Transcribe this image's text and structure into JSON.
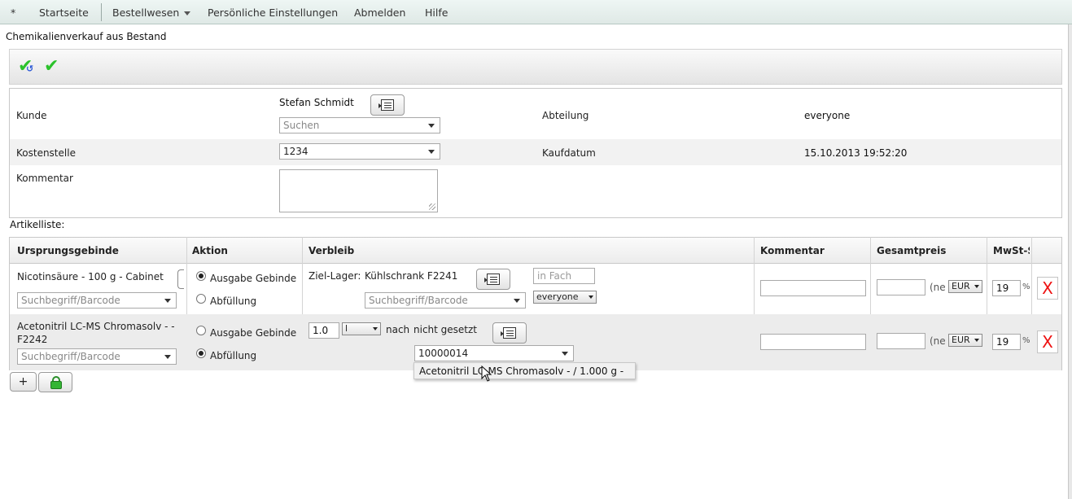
{
  "menu": {
    "star": "*",
    "home": "Startseite",
    "ordering": "Bestellwesen",
    "personal_settings": "Persönliche Einstellungen",
    "logout": "Abmelden",
    "help": "Hilfe"
  },
  "page_title": "Chemikalienverkauf aus Bestand",
  "form": {
    "customer_label": "Kunde",
    "customer_name": "Stefan Schmidt",
    "customer_search_placeholder": "Suchen",
    "department_label": "Abteilung",
    "department_value": "everyone",
    "cost_center_label": "Kostenstelle",
    "cost_center_value": "1234",
    "purchase_date_label": "Kaufdatum",
    "purchase_date_value": "15.10.2013 19:52:20",
    "comment_label": "Kommentar",
    "comment_value": ""
  },
  "article_list_label": "Artikelliste:",
  "table": {
    "headers": {
      "origin": "Ursprungsgebinde",
      "action": "Aktion",
      "destination": "Verbleib",
      "comment": "Kommentar",
      "total_price": "Gesamtpreis",
      "vat": "MwSt-S"
    },
    "rows": [
      {
        "origin_name": "Nicotinsäure - 100 g - Cabinet",
        "origin_search_placeholder": "Suchbegriff/Barcode",
        "action_issue": "Ausgabe Gebinde",
        "action_fill": "Abfüllung",
        "target_storage_label": "Ziel-Lager:",
        "target_storage_value": "Kühlschrank F2241",
        "compartment_placeholder": "in Fach",
        "destination_search_placeholder": "Suchbegriff/Barcode",
        "owner_select": "everyone",
        "comment_value": "",
        "price_value": "",
        "price_suffix": "(ne",
        "currency": "EUR",
        "vat_value": "19",
        "vat_unit": "%",
        "delete_label": "X"
      },
      {
        "origin_name_line1": "Acetonitril LC-MS Chromasolv - -",
        "origin_name_line2": "F2242",
        "origin_search_placeholder": "Suchbegriff/Barcode",
        "action_issue": "Ausgabe Gebinde",
        "action_fill": "Abfüllung",
        "amount_value": "1.0",
        "unit_select": "l",
        "after_label": "nach",
        "not_set_label": "nicht gesetzt",
        "barcode_value": "10000014",
        "comment_value": "",
        "price_value": "",
        "price_suffix": "(ne",
        "currency": "EUR",
        "vat_value": "19",
        "vat_unit": "%",
        "delete_label": "X"
      }
    ]
  },
  "add_row_label": "+",
  "autocomplete_suggestion": "Acetonitril LC-MS Chromasolv -  / 1.000 g -",
  "colors": {
    "check_green": "#2bc22b",
    "delete_red": "#ee1111",
    "lock_green": "#34b534"
  },
  "icons": [
    "check-refresh-icon",
    "check-icon",
    "list-select-icon",
    "lock-icon",
    "mouse-cursor-icon"
  ]
}
